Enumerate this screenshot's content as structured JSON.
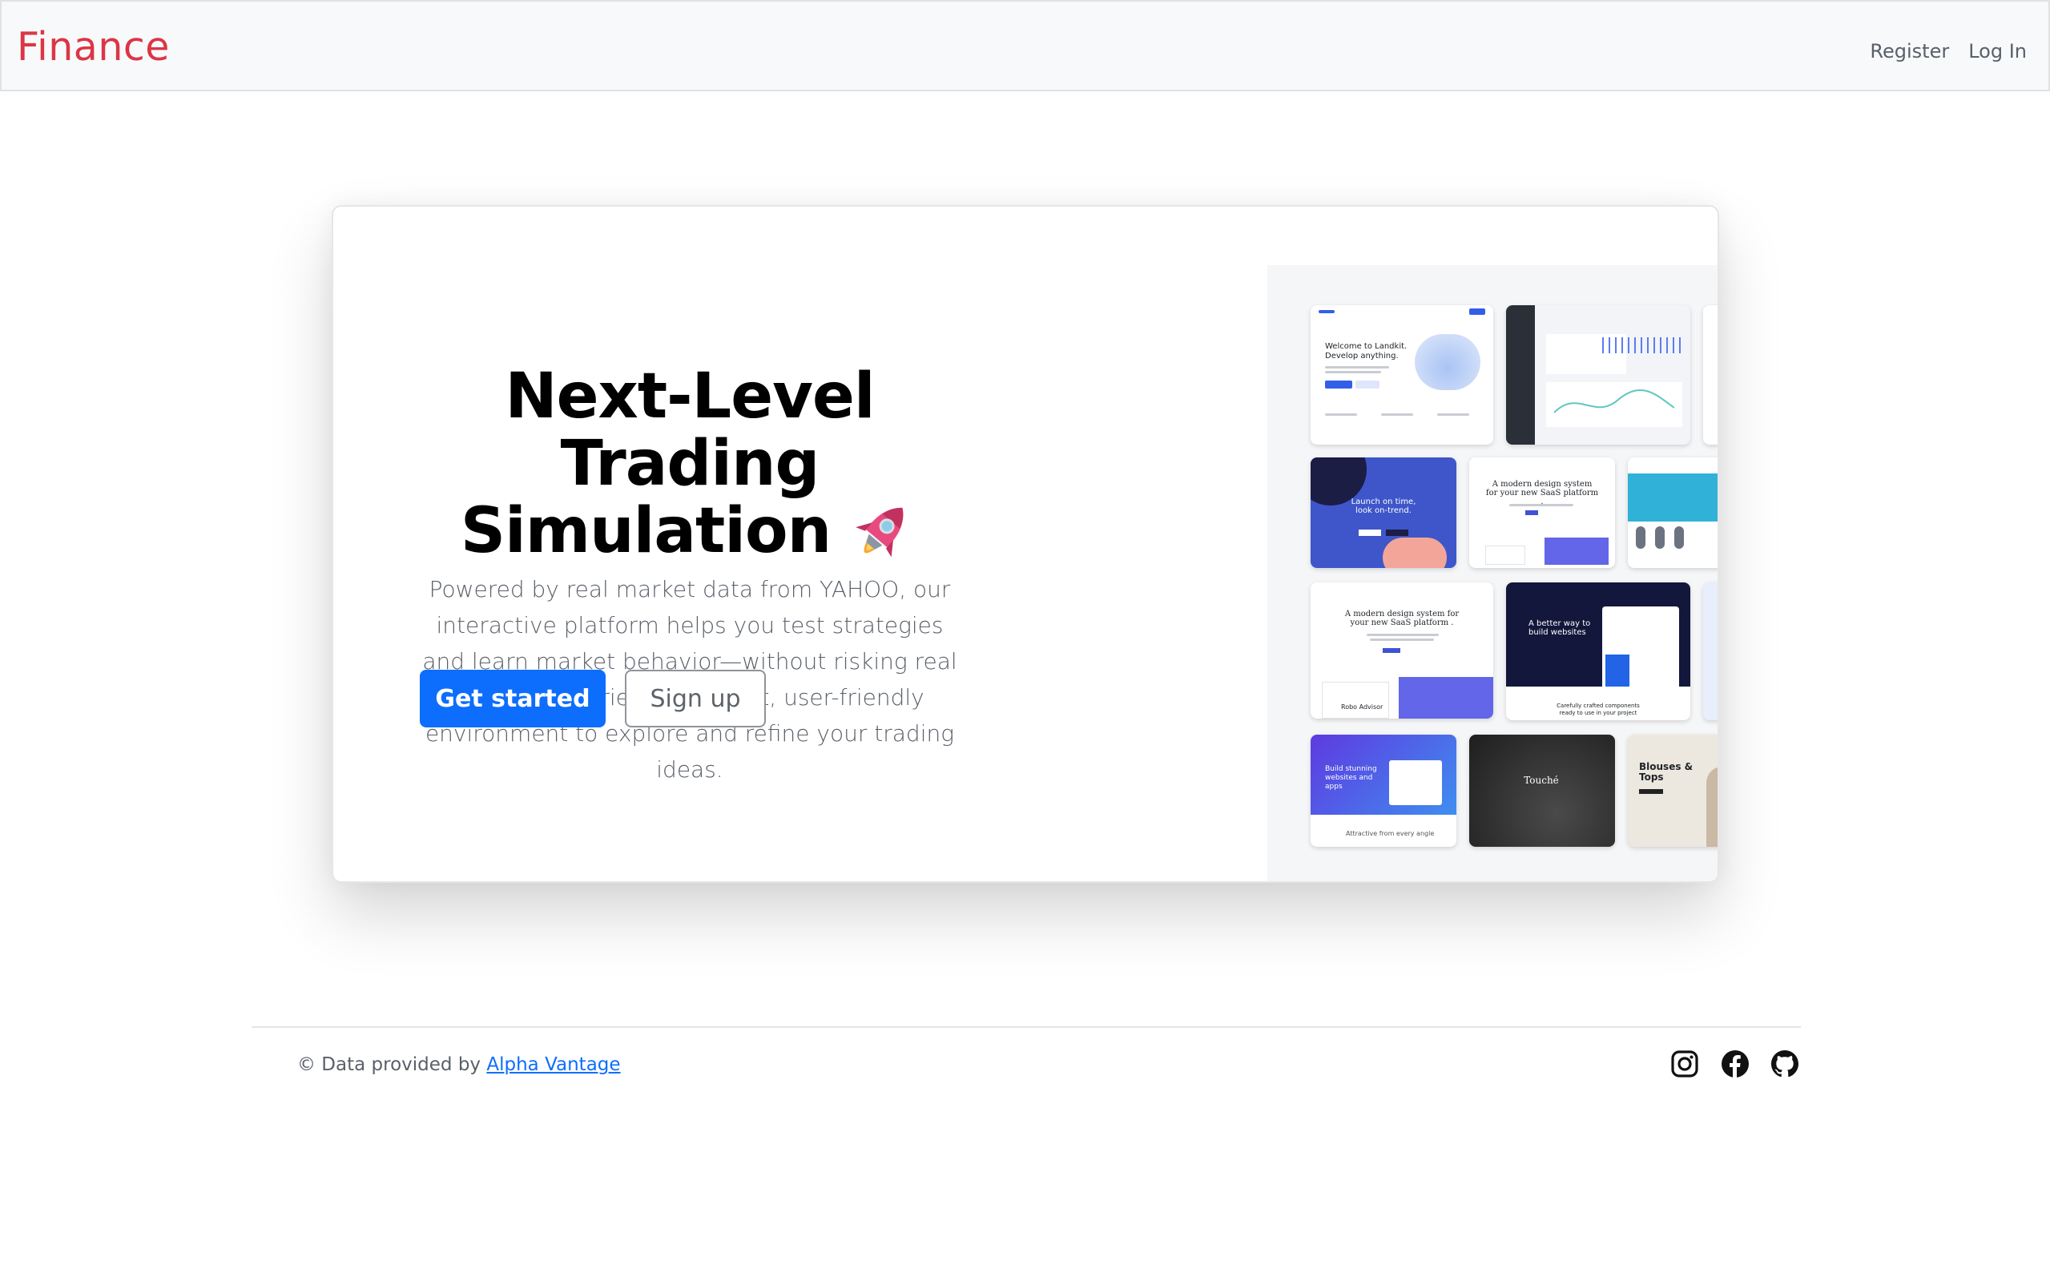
{
  "navbar": {
    "brand": "Finance",
    "links": [
      "Register",
      "Log In"
    ],
    "brand_color": "#dc3545"
  },
  "hero": {
    "title": "Next-Level Trading Simulation",
    "rocket_icon": "rocket-icon",
    "description": "Powered by real market data from YAHOO, our interactive platform helps you test strategies and learn market behavior—without risking real capital. Experience a robust, user-friendly environment to explore and refine your trading ideas.",
    "primary_button": "Get started",
    "secondary_button": "Sign up",
    "primary_color": "#0d6efd"
  },
  "preview": {
    "tiles": {
      "landkit_welcome": "Welcome to Landkit.",
      "landkit_develop": "Develop anything.",
      "launch_time": "Launch on time, look on-trend.",
      "design_system": "A modern design system for your new SaaS platform .",
      "design_system_2": "A modern design system for your new SaaS platform .",
      "better_way": "A better way to build websites",
      "carefully_crafted": "Carefully crafted components ready to use in your project",
      "build_stunning": "Build stunning websites and apps",
      "attractive": "Attractive from every angle",
      "touche": "Touché",
      "blouses": "Blouses & Tops",
      "robo_advisor": "Robo Advisor"
    }
  },
  "footer": {
    "prefix": "© Data provided by",
    "link_text": "Alpha Vantage",
    "icons": [
      "instagram-icon",
      "facebook-icon",
      "github-icon"
    ]
  }
}
